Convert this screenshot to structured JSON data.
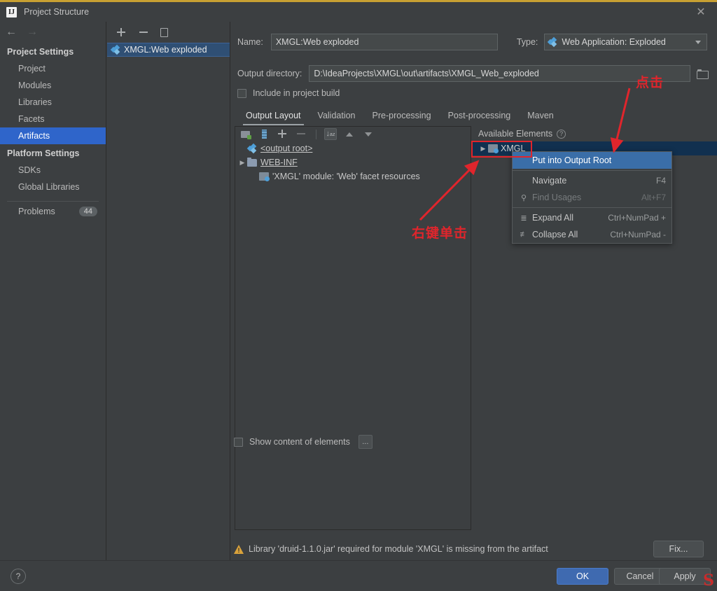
{
  "window": {
    "title": "Project Structure",
    "app_icon": "idea-icon",
    "close_label": "✕",
    "accent_top_color": "#c8a032"
  },
  "nav": {
    "back": "←",
    "forward": "→"
  },
  "sidebar": {
    "project_settings_title": "Project Settings",
    "project_items": [
      {
        "label": "Project",
        "selected": false
      },
      {
        "label": "Modules",
        "selected": false
      },
      {
        "label": "Libraries",
        "selected": false
      },
      {
        "label": "Facets",
        "selected": false
      },
      {
        "label": "Artifacts",
        "selected": true
      }
    ],
    "platform_settings_title": "Platform Settings",
    "platform_items": [
      {
        "label": "SDKs",
        "selected": false
      },
      {
        "label": "Global Libraries",
        "selected": false
      }
    ],
    "problems_label": "Problems",
    "problems_count": "44"
  },
  "artifact_list": {
    "toolbar": [
      {
        "name": "add-artifact-button",
        "glyph": "+"
      },
      {
        "name": "remove-artifact-button",
        "glyph": "−"
      },
      {
        "name": "copy-artifact-button",
        "glyph": "⧉"
      }
    ],
    "items": [
      {
        "label": "XMGL:Web exploded",
        "icon": "artifact-icon",
        "selected": true
      }
    ]
  },
  "form": {
    "name_label": "Name:",
    "name_value": "XMGL:Web exploded",
    "type_label": "Type:",
    "type_value": "Web Application: Exploded",
    "type_icon": "artifact-icon",
    "output_dir_label": "Output directory:",
    "output_dir_value": "D:\\IdeaProjects\\XMGL\\out\\artifacts\\XMGL_Web_exploded",
    "browse_icon": "folder-browse-icon",
    "include_in_build_label": "Include in project build",
    "include_in_build_checked": false
  },
  "tabs": [
    {
      "label": "Output Layout",
      "active": true
    },
    {
      "label": "Validation",
      "active": false
    },
    {
      "label": "Pre-processing",
      "active": false
    },
    {
      "label": "Post-processing",
      "active": false
    },
    {
      "label": "Maven",
      "active": false
    }
  ],
  "output_layout": {
    "toolbar": [
      {
        "name": "add-directory-content-button",
        "glyph": "▤"
      },
      {
        "name": "create-archive-button",
        "glyph": "▉"
      },
      {
        "name": "add-copy-button",
        "glyph": "+"
      },
      {
        "name": "remove-button",
        "glyph": "−"
      },
      {
        "name": "sort-alphabetically-button",
        "glyph": "↓"
      },
      {
        "name": "move-up-button",
        "glyph": "▲"
      },
      {
        "name": "move-down-button",
        "glyph": "▼"
      }
    ],
    "tree": [
      {
        "label": "<output root>",
        "icon": "artifact-icon",
        "indent": 0,
        "twisty": ""
      },
      {
        "label": "WEB-INF",
        "icon": "folder-icon",
        "indent": 0,
        "twisty": "▶"
      },
      {
        "label": "'XMGL' module: 'Web' facet resources",
        "icon": "module-icon",
        "indent": 1,
        "twisty": ""
      }
    ]
  },
  "available_elements": {
    "title": "Available Elements",
    "help_glyph": "?",
    "rows": [
      {
        "label": "XMGL",
        "icon": "module-icon",
        "twisty": "▶",
        "selected": true
      }
    ]
  },
  "context_menu": {
    "items": [
      {
        "label": "Put into Output Root",
        "shortcut": "",
        "icon": "",
        "highlighted": true,
        "disabled": false
      },
      {
        "label": "Navigate",
        "shortcut": "F4",
        "icon": "",
        "highlighted": false,
        "disabled": false
      },
      {
        "label": "Find Usages",
        "shortcut": "Alt+F7",
        "icon": "search-icon",
        "highlighted": false,
        "disabled": true
      },
      {
        "label": "Expand All",
        "shortcut": "Ctrl+NumPad +",
        "icon": "expand-all-icon",
        "highlighted": false,
        "disabled": false
      },
      {
        "label": "Collapse All",
        "shortcut": "Ctrl+NumPad -",
        "icon": "collapse-all-icon",
        "highlighted": false,
        "disabled": false
      }
    ]
  },
  "bottom": {
    "show_content_label": "Show content of elements",
    "show_content_checked": false,
    "dots_label": "...",
    "warning_text": "Library 'druid-1.1.0.jar' required for module 'XMGL' is missing from the artifact",
    "fix_label": "Fix...",
    "help_glyph": "?",
    "ok_label": "OK",
    "cancel_label": "Cancel",
    "apply_label": "Apply"
  },
  "annotations": {
    "click_text": "点击",
    "right_click_text": "右键单击",
    "annotation_color": "#e0252c",
    "watermark": "S"
  }
}
